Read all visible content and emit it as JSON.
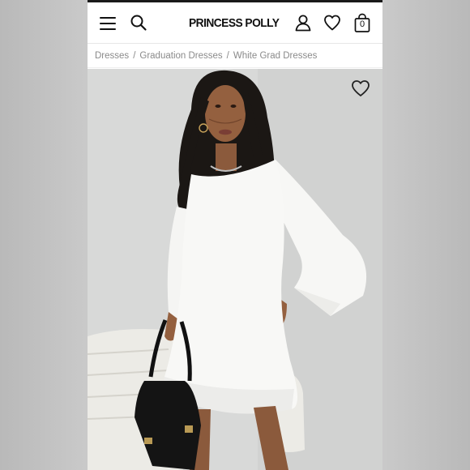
{
  "header": {
    "brand": "PRINCESS POLLY",
    "bag_count": "0",
    "icons": {
      "menu": "hamburger-menu-icon",
      "search": "search-icon",
      "account": "user-icon",
      "wishlist": "heart-icon",
      "bag": "shopping-bag-icon"
    }
  },
  "breadcrumb": {
    "items": [
      "Dresses",
      "Graduation Dresses",
      "White Grad Dresses"
    ],
    "separator": "/"
  },
  "product_image": {
    "alt": "Model wearing white long sleeve mini dress holding black handbag",
    "wishlist_icon": "heart-outline-icon"
  },
  "colors": {
    "header_bar": "#1a1a1a",
    "breadcrumb_text": "#8a8a8a",
    "background": "#ffffff"
  }
}
